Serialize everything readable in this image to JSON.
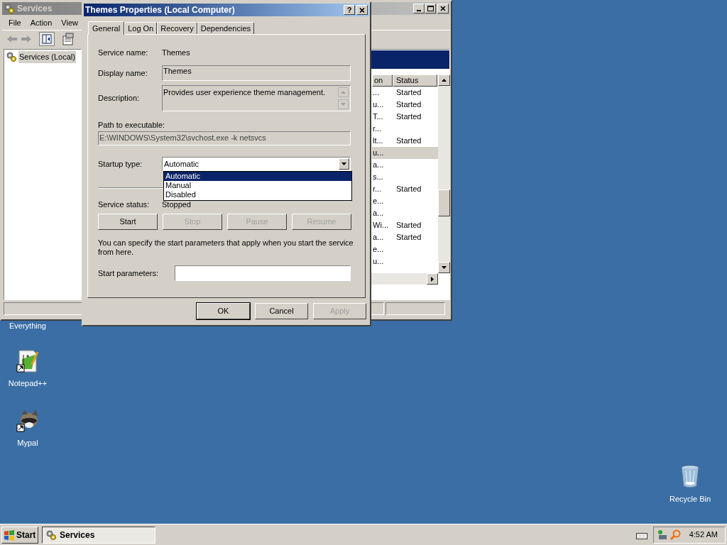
{
  "desktop_icons": [
    {
      "label": "Everything",
      "kind": "label_only"
    },
    {
      "label": "Notepad++",
      "kind": "notepad"
    },
    {
      "label": "Mypal",
      "kind": "mypal"
    },
    {
      "label": "Recycle Bin",
      "kind": "recycle"
    }
  ],
  "services_window": {
    "title": "Services",
    "active": false,
    "menu": [
      "File",
      "Action",
      "View"
    ],
    "tree": [
      {
        "label": "Services (Local)",
        "selected": true
      }
    ],
    "columns": [
      "on",
      "Status"
    ],
    "rows": [
      {
        "column_1": "...",
        "status": "Started",
        "selected": false
      },
      {
        "column_1": "u...",
        "status": "Started",
        "selected": false
      },
      {
        "column_1": "T...",
        "status": "Started",
        "selected": false
      },
      {
        "column_1": "r...",
        "status": "",
        "selected": false
      },
      {
        "column_1": "lt...",
        "status": "Started",
        "selected": false
      },
      {
        "column_1": "u...",
        "status": "",
        "selected": true
      },
      {
        "column_1": "a...",
        "status": "",
        "selected": false
      },
      {
        "column_1": "s...",
        "status": "",
        "selected": false
      },
      {
        "column_1": "r...",
        "status": "Started",
        "selected": false
      },
      {
        "column_1": "e...",
        "status": "",
        "selected": false
      },
      {
        "column_1": "a...",
        "status": "",
        "selected": false
      },
      {
        "column_1": "Wi...",
        "status": "Started",
        "selected": false
      },
      {
        "column_1": "a...",
        "status": "Started",
        "selected": false
      },
      {
        "column_1": "e...",
        "status": "",
        "selected": false
      },
      {
        "column_1": "u...",
        "status": "",
        "selected": false
      }
    ]
  },
  "dialog": {
    "title": "Themes Properties (Local Computer)",
    "active": true,
    "help": "?",
    "tabs": [
      {
        "label": "General",
        "selected": true
      },
      {
        "label": "Log On",
        "selected": false
      },
      {
        "label": "Recovery",
        "selected": false
      },
      {
        "label": "Dependencies",
        "selected": false
      }
    ],
    "service_name": {
      "label": "Service name:",
      "value": "Themes"
    },
    "display_name": {
      "label": "Display name:",
      "value": "Themes"
    },
    "description": {
      "label": "Description:",
      "value": "Provides user experience theme management."
    },
    "path": {
      "label": "Path to executable:",
      "value": "E:\\WINDOWS\\System32\\svchost.exe -k netsvcs"
    },
    "startup_type": {
      "label": "Startup type:",
      "value": "Automatic",
      "expanded": true,
      "options": [
        {
          "label": "Automatic",
          "selected": true
        },
        {
          "label": "Manual",
          "selected": false
        },
        {
          "label": "Disabled",
          "selected": false
        }
      ]
    },
    "service_status": {
      "label": "Service status:",
      "value": "Stopped"
    },
    "service_buttons": [
      {
        "label": "Start",
        "disabled": false
      },
      {
        "label": "Stop",
        "disabled": true
      },
      {
        "label": "Pause",
        "disabled": true
      },
      {
        "label": "Resume",
        "disabled": true
      }
    ],
    "note": "You can specify the start parameters that apply when you start the service from here.",
    "start_parameters": {
      "label": "Start parameters:"
    },
    "buttons": [
      {
        "label": "OK",
        "disabled": false,
        "default": true
      },
      {
        "label": "Cancel",
        "disabled": false,
        "default": false
      },
      {
        "label": "Apply",
        "disabled": true,
        "default": false
      }
    ]
  },
  "taskbar": {
    "start": "Start",
    "tasks": [
      {
        "label": "Services",
        "selected": true
      }
    ],
    "clock": "4:52 AM"
  }
}
